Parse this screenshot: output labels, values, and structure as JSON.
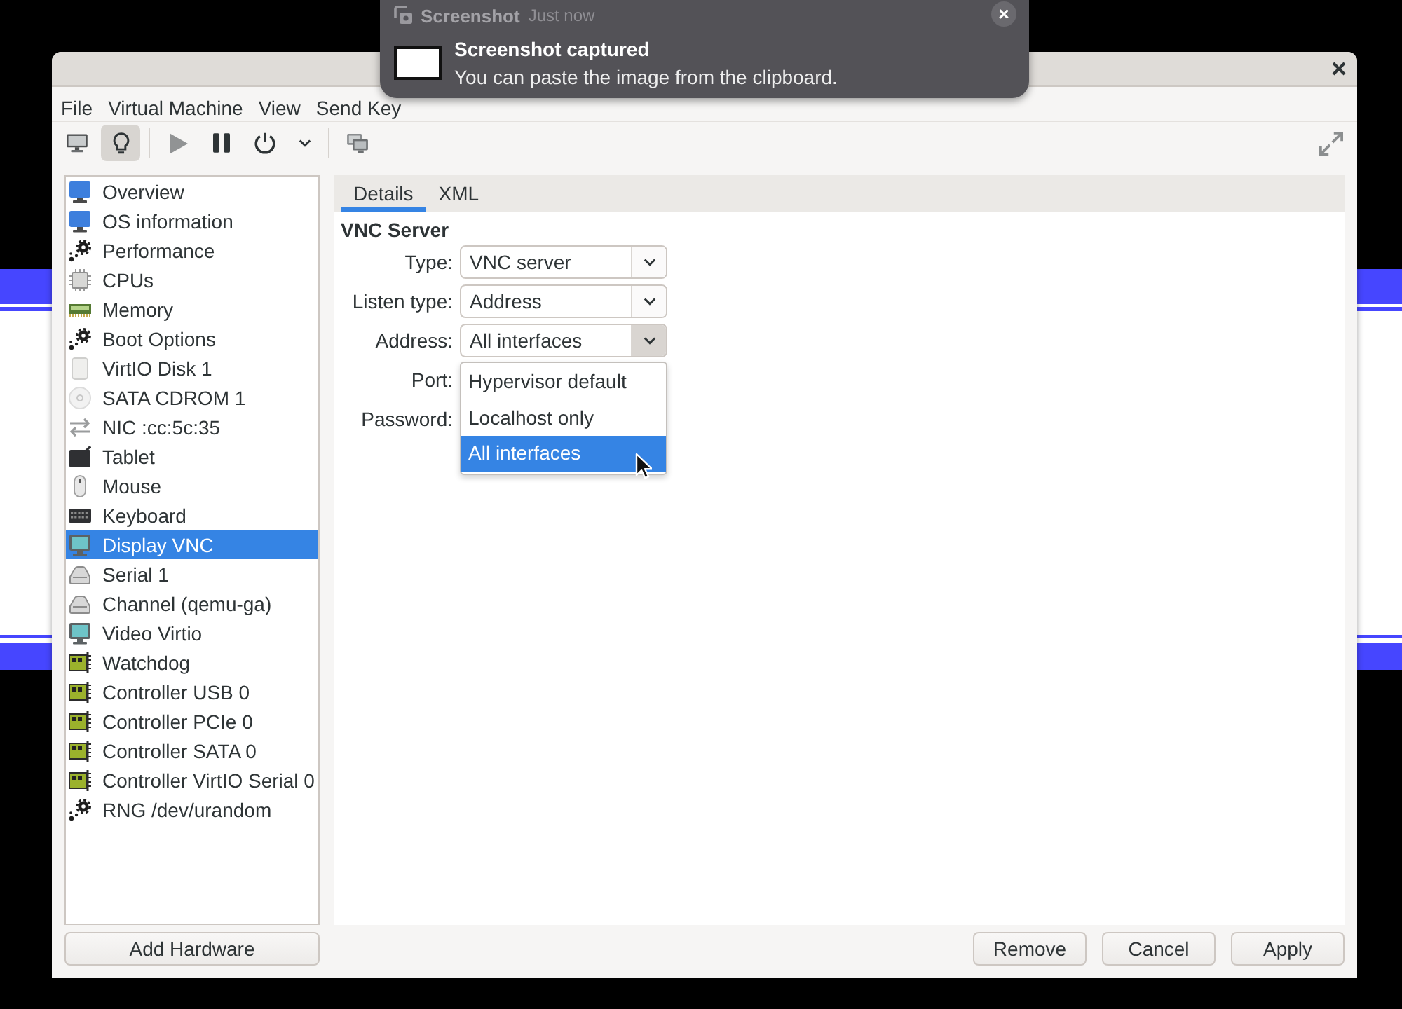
{
  "notification": {
    "app": "Screenshot",
    "time": "Just now",
    "title": "Screenshot captured",
    "body": "You can paste the image from the clipboard."
  },
  "menu": [
    "File",
    "Virtual Machine",
    "View",
    "Send Key"
  ],
  "toolbar": {
    "groups": [
      [
        {
          "kind": "console",
          "selected": false,
          "disabled": false
        },
        {
          "kind": "details",
          "selected": true,
          "disabled": false
        }
      ],
      [
        {
          "kind": "run",
          "selected": false,
          "disabled": true
        },
        {
          "kind": "pause",
          "selected": false,
          "disabled": false
        },
        {
          "kind": "shutdown",
          "selected": false,
          "disabled": false
        },
        {
          "kind": "shutdown_menu",
          "selected": false,
          "disabled": false
        }
      ],
      [
        {
          "kind": "snapshots",
          "selected": false,
          "disabled": false
        }
      ]
    ]
  },
  "sidebar": {
    "items": [
      {
        "label": "Overview",
        "kind": "monitor",
        "selected": false
      },
      {
        "label": "OS information",
        "kind": "monitor",
        "selected": false
      },
      {
        "label": "Performance",
        "kind": "gear",
        "selected": false
      },
      {
        "label": "CPUs",
        "kind": "chip",
        "selected": false
      },
      {
        "label": "Memory",
        "kind": "memory",
        "selected": false
      },
      {
        "label": "Boot Options",
        "kind": "gear",
        "selected": false
      },
      {
        "label": "VirtIO Disk 1",
        "kind": "disk",
        "selected": false
      },
      {
        "label": "SATA CDROM 1",
        "kind": "cdrom",
        "selected": false
      },
      {
        "label": "NIC :cc:5c:35",
        "kind": "network",
        "selected": false
      },
      {
        "label": "Tablet",
        "kind": "tablet",
        "selected": false
      },
      {
        "label": "Mouse",
        "kind": "mouse",
        "selected": false
      },
      {
        "label": "Keyboard",
        "kind": "keyboard",
        "selected": false
      },
      {
        "label": "Display VNC",
        "kind": "display",
        "selected": true
      },
      {
        "label": "Serial 1",
        "kind": "serial",
        "selected": false
      },
      {
        "label": "Channel (qemu-ga)",
        "kind": "serial",
        "selected": false
      },
      {
        "label": "Video Virtio",
        "kind": "display",
        "selected": false
      },
      {
        "label": "Watchdog",
        "kind": "card",
        "selected": false
      },
      {
        "label": "Controller USB 0",
        "kind": "card",
        "selected": false
      },
      {
        "label": "Controller PCIe 0",
        "kind": "card",
        "selected": false
      },
      {
        "label": "Controller SATA 0",
        "kind": "card",
        "selected": false
      },
      {
        "label": "Controller VirtIO Serial 0",
        "kind": "card",
        "selected": false
      },
      {
        "label": "RNG /dev/urandom",
        "kind": "gear",
        "selected": false
      }
    ]
  },
  "tabs": [
    {
      "label": "Details",
      "selected": true
    },
    {
      "label": "XML",
      "selected": false
    }
  ],
  "section": {
    "title": "VNC Server",
    "fields": [
      {
        "label": "Type:",
        "kind": "combo",
        "value": "VNC server",
        "open": false
      },
      {
        "label": "Listen type:",
        "kind": "combo",
        "value": "Address",
        "open": false
      },
      {
        "label": "Address:",
        "kind": "combo",
        "value": "All interfaces",
        "open": true,
        "options": [
          {
            "label": "Hypervisor default",
            "selected": false
          },
          {
            "label": "Localhost only",
            "selected": false
          },
          {
            "label": "All interfaces",
            "selected": true
          }
        ]
      },
      {
        "label": "Port:"
      },
      {
        "label": "Password:"
      }
    ]
  },
  "add_hardware": "Add Hardware",
  "buttons": [
    "Remove",
    "Cancel",
    "Apply"
  ]
}
